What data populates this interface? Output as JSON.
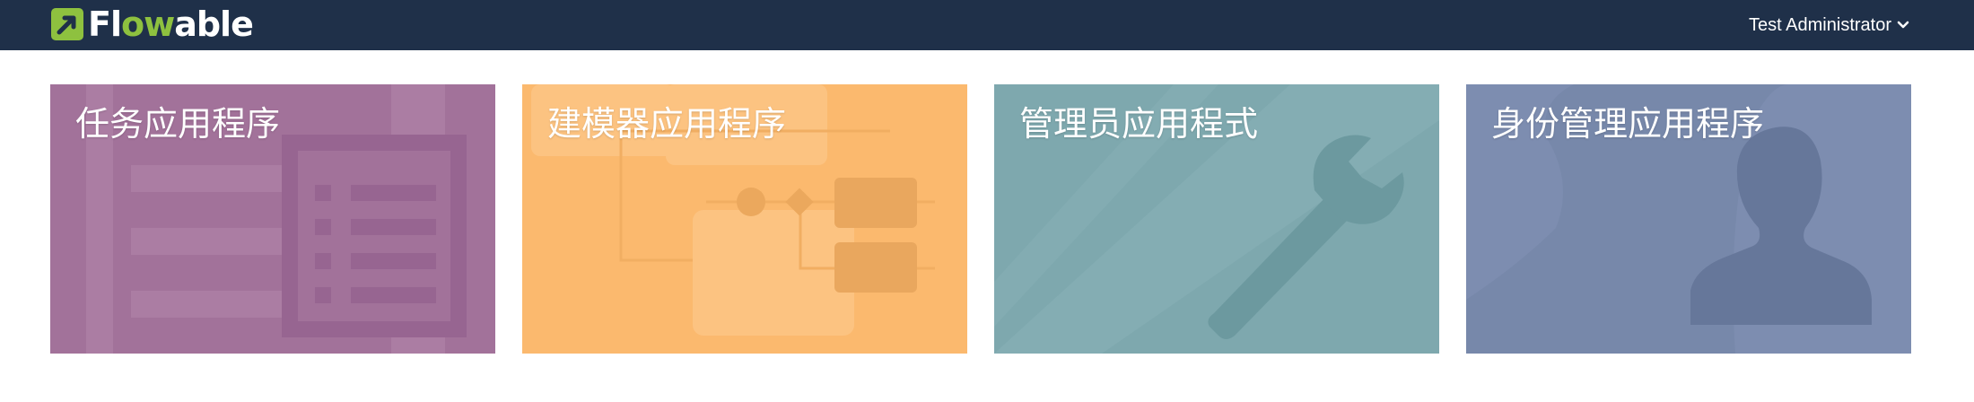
{
  "header": {
    "logo_text_a": "Fl",
    "logo_text_b": "ow",
    "logo_text_c": "able",
    "user_name": "Test Administrator",
    "background": "#1f3049",
    "accent": "#8ec13f"
  },
  "apps": [
    {
      "title": "任务应用程序",
      "color": "#a2729a",
      "icon": "task-list-icon"
    },
    {
      "title": "建模器应用程序",
      "color": "#fbb96e",
      "icon": "process-diagram-icon"
    },
    {
      "title": "管理员应用程式",
      "color": "#7ea8ae",
      "icon": "wrench-icon"
    },
    {
      "title": "身份管理应用程序",
      "color": "#7788aa",
      "icon": "user-silhouette-icon"
    }
  ]
}
